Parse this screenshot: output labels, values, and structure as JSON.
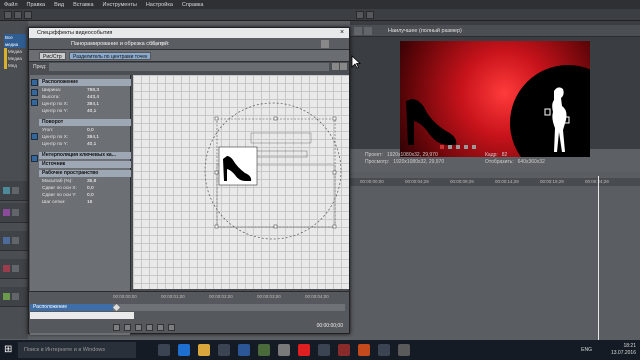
{
  "menu": {
    "items": [
      "Файл",
      "Правка",
      "Вид",
      "Вставка",
      "Инструменты",
      "Настройка",
      "Справка"
    ]
  },
  "left_mini": {
    "line1": "Все медиа",
    "line2": "Медиа",
    "line3": "Медиа",
    "line4": "Мед"
  },
  "preview": {
    "label": "Наилучшее (полный размер)"
  },
  "preview_info": {
    "project": "Проект:",
    "project_val": "1920x1080x32, 29,970",
    "preview_l": "Просмотр:",
    "preview_val": "1920x1080x32, 29,970",
    "frame_l": "Кадр:",
    "frame_val": "82",
    "display_l": "Отобразить:",
    "display_val": "640x360x32"
  },
  "timeline": {
    "ticks": [
      "00:00:00;00",
      "00:00:04;29",
      "00:00:09;29",
      "00:00:14;29",
      "00:00:19;29",
      "00:00:24;29",
      "00:00:29;29"
    ]
  },
  "dialog": {
    "title": "Спецэффекты видеособытия",
    "tab1": "Панорамирование и обрезка событий:",
    "tab1_suffix": "Cf.png",
    "btn_position": "Рис/Стр",
    "btn_align": "Разделитель по центрами точек",
    "preset_label": "Пред:",
    "sections": {
      "position": "Расположение",
      "rotation": "Поворот",
      "keyframe_interp": "Интерполяция ключевых ка...",
      "source": "Источник",
      "workspace": "Рабочее пространство"
    },
    "position_rows": [
      {
        "k": "Ширина:",
        "v": "788,3"
      },
      {
        "k": "Высота:",
        "v": "443,4"
      },
      {
        "k": "Центр по X:",
        "v": "384,1"
      },
      {
        "k": "Центр по Y:",
        "v": "40,1"
      }
    ],
    "rotation_rows": [
      {
        "k": "Угол:",
        "v": "0,0"
      },
      {
        "k": "Центр по X:",
        "v": "384,1"
      },
      {
        "k": "Центр по Y:",
        "v": "40,1"
      }
    ],
    "workspace_rows": [
      {
        "k": "Масштаб (%):",
        "v": "35,8"
      },
      {
        "k": "Сдвиг по оси X:",
        "v": "0,0"
      },
      {
        "k": "Сдвиг по оси Y:",
        "v": "0,0"
      },
      {
        "k": "Шаг сетки:",
        "v": "16"
      }
    ],
    "kf_times": [
      "00:00:00;00",
      "00:00:01;00",
      "00:00:02;00",
      "00:00:03;00",
      "00:00:04;00"
    ],
    "kf_row1": "Расположение",
    "kf_row2": "",
    "kf_time": "00:00:00;00"
  },
  "taskbar": {
    "search": "Поиск в Интернете и в Windows",
    "lang": "ENG",
    "time": "18:21",
    "date": "13.07.2016"
  },
  "colors": {
    "accent": "#3f6ea6",
    "preview_red": "#e02020",
    "section_bg": "#9ea7b4"
  }
}
